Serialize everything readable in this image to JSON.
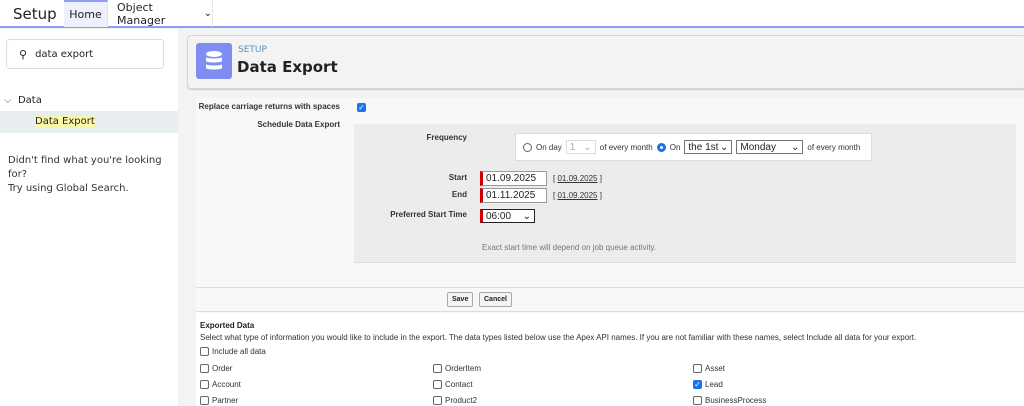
{
  "app_title": "Setup",
  "nav": {
    "tabs": [
      {
        "label": "Home",
        "active": true
      },
      {
        "label": "Object Manager"
      }
    ]
  },
  "sidebar": {
    "search_value": "data export",
    "group": "Data",
    "item": "Data Export",
    "help1": "Didn't find what you're looking for?",
    "help2": "Try using Global Search."
  },
  "header": {
    "eyebrow": "SETUP",
    "title": "Data Export",
    "icon": "database-icon",
    "accent": "#7f8df2"
  },
  "form": {
    "replace_label": "Replace carriage returns with spaces",
    "replace_checked": true,
    "schedule_label": "Schedule Data Export",
    "frequency_label": "Frequency",
    "on_day": "On day",
    "day_value": "1",
    "of_every_month": "of every month",
    "on": "On",
    "ordinal": "the 1st",
    "weekday": "Monday",
    "start_label": "Start",
    "start_value": "01.09.2025",
    "start_hint": "01.09.2025",
    "end_label": "End",
    "end_value": "01.11.2025",
    "end_hint": "01.09.2025",
    "time_label": "Preferred Start Time",
    "time_value": "06:00",
    "note": "Exact start time will depend on job queue activity.",
    "save": "Save",
    "cancel": "Cancel"
  },
  "exported": {
    "title": "Exported Data",
    "desc": "Select what type of information you would like to include in the export. The data types listed below use the Apex API names. If you are not familiar with these names, select Include all data for your export.",
    "include_all": "Include all data",
    "items": [
      {
        "label": "Order",
        "checked": false
      },
      {
        "label": "OrderItem",
        "checked": false
      },
      {
        "label": "Asset",
        "checked": false
      },
      {
        "label": "Account",
        "checked": false
      },
      {
        "label": "Contact",
        "checked": false
      },
      {
        "label": "Lead",
        "checked": true
      },
      {
        "label": "Partner",
        "checked": false
      },
      {
        "label": "Product2",
        "checked": false
      },
      {
        "label": "BusinessProcess",
        "checked": false
      }
    ]
  }
}
